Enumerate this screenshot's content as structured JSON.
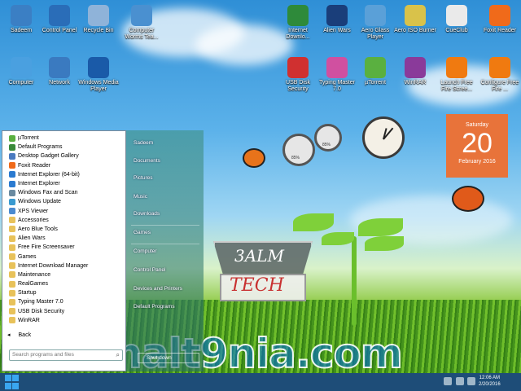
{
  "desktop_icons": [
    {
      "label": "Sadeem",
      "icon": "folder-user-icon",
      "color": "#3b7fc4"
    },
    {
      "label": "Control Panel",
      "icon": "control-panel-icon",
      "color": "#2a6db8"
    },
    {
      "label": "Recycle Bin",
      "icon": "recycle-bin-icon",
      "color": "#8fb3d9"
    },
    {
      "label": "Computer Worms Tea...",
      "icon": "monitor-icon",
      "color": "#4a90d0"
    },
    {
      "label": "Internet Downlo...",
      "icon": "idm-icon",
      "color": "#2e8a3a"
    },
    {
      "label": "Alien Wars",
      "icon": "alien-wars-icon",
      "color": "#1a3e7a"
    },
    {
      "label": "Aero Glass Player",
      "icon": "media-player-icon",
      "color": "#5aa0d8"
    },
    {
      "label": "Aero ISO Burner",
      "icon": "disc-icon",
      "color": "#d9c24a"
    },
    {
      "label": "CueClub",
      "icon": "cueclub-icon",
      "color": "#eaeaea"
    },
    {
      "label": "Foxit Reader",
      "icon": "foxit-icon",
      "color": "#f06a1a"
    },
    {
      "label": "Computer",
      "icon": "computer-icon",
      "color": "#4aa0e0"
    },
    {
      "label": "Network",
      "icon": "network-icon",
      "color": "#3a7ac0"
    },
    {
      "label": "Windows Media Player",
      "icon": "wmp-icon",
      "color": "#1a5aa8"
    },
    {
      "label": "USB Disk Security",
      "icon": "shield-icon",
      "color": "#d03030"
    },
    {
      "label": "Typing Master 7.0",
      "icon": "typing-icon",
      "color": "#d050a0"
    },
    {
      "label": "µTorrent",
      "icon": "utorrent-icon",
      "color": "#5ab040"
    },
    {
      "label": "WinRAR",
      "icon": "winrar-icon",
      "color": "#8a3a9a"
    },
    {
      "label": "Launch Free Fire Scree...",
      "icon": "fire-icon",
      "color": "#f07a10"
    },
    {
      "label": "Configure Free Fire ...",
      "icon": "fire-icon",
      "color": "#f07a10"
    }
  ],
  "start_menu": {
    "programs": [
      {
        "label": "µTorrent",
        "type": "app",
        "color": "#5ab040"
      },
      {
        "label": "Default Programs",
        "type": "app",
        "color": "#3a8a3a"
      },
      {
        "label": "Desktop Gadget Gallery",
        "type": "app",
        "color": "#4a7ac0"
      },
      {
        "label": "Foxit Reader",
        "type": "app",
        "color": "#f06a1a"
      },
      {
        "label": "Internet Explorer (64-bit)",
        "type": "app",
        "color": "#2a7ad0"
      },
      {
        "label": "Internet Explorer",
        "type": "app",
        "color": "#2a7ad0"
      },
      {
        "label": "Windows Fax and Scan",
        "type": "app",
        "color": "#6a8aa0"
      },
      {
        "label": "Windows Update",
        "type": "app",
        "color": "#3a9ad0"
      },
      {
        "label": "XPS Viewer",
        "type": "app",
        "color": "#4a8ad0"
      },
      {
        "label": "Accessories",
        "type": "folder"
      },
      {
        "label": "Aero Blue Tools",
        "type": "folder"
      },
      {
        "label": "Alien Wars",
        "type": "folder"
      },
      {
        "label": "Free Fire Screensaver",
        "type": "folder"
      },
      {
        "label": "Games",
        "type": "folder"
      },
      {
        "label": "Internet Download Manager",
        "type": "folder"
      },
      {
        "label": "Maintenance",
        "type": "folder"
      },
      {
        "label": "RealGames",
        "type": "folder"
      },
      {
        "label": "Startup",
        "type": "folder"
      },
      {
        "label": "Typing Master 7.0",
        "type": "folder"
      },
      {
        "label": "USB Disk Security",
        "type": "folder"
      },
      {
        "label": "WinRAR",
        "type": "folder"
      }
    ],
    "back_label": "Back",
    "search_placeholder": "Search programs and files",
    "right_items": [
      "Sadeem",
      "Documents",
      "Pictures",
      "Music",
      "Downloads",
      "Games",
      "Computer",
      "Control Panel",
      "Devices and Printers",
      "Default Programs"
    ],
    "shutdown_label": "Shut down"
  },
  "gadgets": {
    "calendar": {
      "day_name": "Saturday",
      "day": "20",
      "month_year": "February 2016"
    },
    "meters": [
      "85%",
      "85%"
    ]
  },
  "logo": {
    "line1": "3ALM",
    "line2": "TECH"
  },
  "watermark": "3almalt9nia.com",
  "taskbar": {
    "time": "12:06 AM",
    "date": "2/20/2016"
  }
}
